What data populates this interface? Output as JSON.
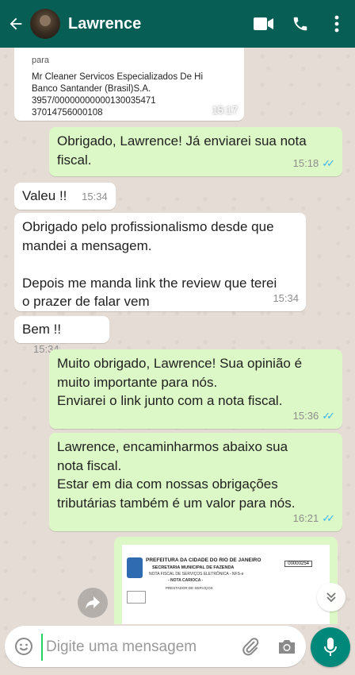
{
  "header": {
    "contact_name": "Lawrence",
    "icons": [
      "back-arrow-icon",
      "video-call-icon",
      "phone-icon",
      "more-vert-icon"
    ]
  },
  "messages": [
    {
      "kind": "document-preview",
      "direction": "in",
      "prefix": "para",
      "lines": "Mr Cleaner Servicos Especializados De Hi\nBanco Santander (Brasil)S.A.\n3957/00000000000130035471\n37014756000108",
      "time": "15:17"
    },
    {
      "direction": "out",
      "text": "Obrigado, Lawrence! Já enviarei sua nota\nfiscal.",
      "time": "15:18"
    },
    {
      "direction": "in",
      "text": "Valeu !!",
      "time": "15:34"
    },
    {
      "direction": "in",
      "text": "Obrigado pelo profissionalismo desde que\nmandei a mensagem.\n\nDepois me manda link the review que terei\no prazer de falar vem",
      "time": "15:34"
    },
    {
      "direction": "in",
      "text": "Bem !!",
      "time": "15:34"
    },
    {
      "direction": "out",
      "text": "Muito obrigado, Lawrence! Sua opinião é\nmuito importante para nós.\nEnviarei o link junto com a nota fiscal.",
      "time": "15:36"
    },
    {
      "direction": "out",
      "text": "Lawrence, encaminharmos abaixo sua\nnota fiscal.\nEstar em dia com nossas obrigações\ntributárias também é um valor para nós.",
      "time": "16:21"
    }
  ],
  "image_message": {
    "line1": "PREFEITURA DA CIDADE DO RIO DE JANEIRO",
    "line2": "SECRETARIA MUNICIPAL DE FAZENDA",
    "line3": "NOTA FISCAL DE SERVIÇOS ELETRÔNICA - NFS-e",
    "line4": "- NOTA CARIOCA -",
    "line5": "PRESTADOR DE SERVIÇOS",
    "number": "00000254"
  },
  "composer": {
    "placeholder": "Digite uma mensagem",
    "icons": [
      "emoji-icon",
      "attach-clip-icon",
      "camera-icon",
      "mic-icon"
    ]
  },
  "colors": {
    "header": "#075e54",
    "outgoing_bubble": "#dcf8c6",
    "incoming_bubble": "#ffffff",
    "read_ticks": "#34b7f1",
    "mic_button": "#00897b"
  }
}
